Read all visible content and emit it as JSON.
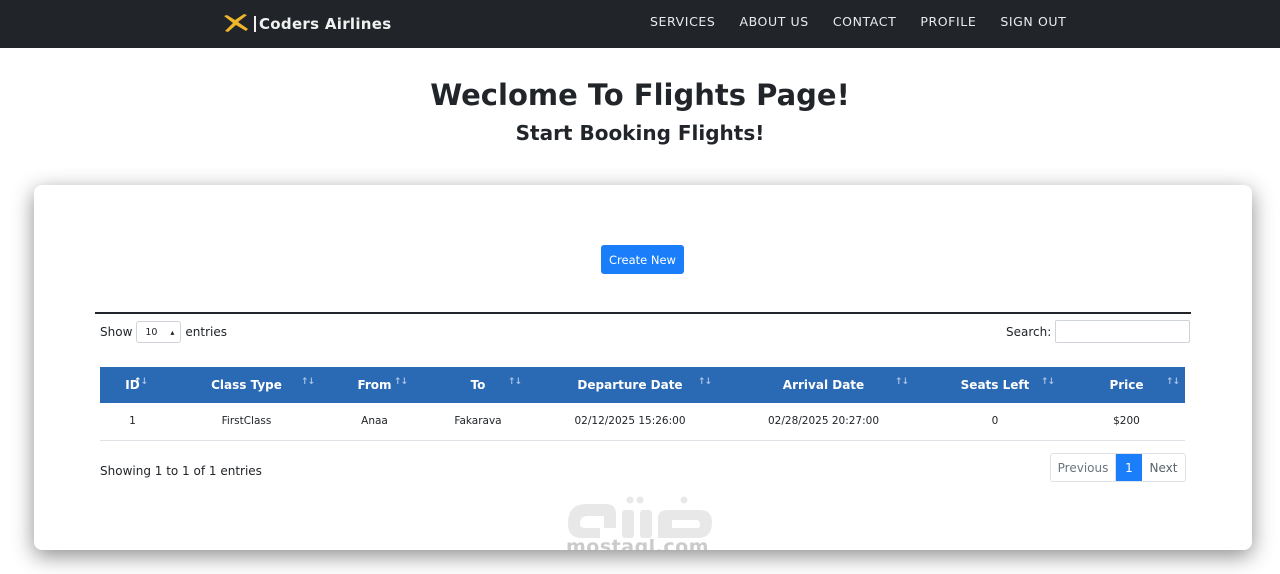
{
  "brand": {
    "name": "Coders Airlines",
    "icon": "airplane-icon",
    "accent": "#f0b62a"
  },
  "nav": {
    "items": [
      {
        "label": "SERVICES"
      },
      {
        "label": "ABOUT US"
      },
      {
        "label": "CONTACT"
      },
      {
        "label": "PROFILE"
      },
      {
        "label": "SIGN OUT"
      }
    ]
  },
  "page": {
    "title": "Weclome To Flights Page!",
    "subtitle": "Start Booking Flights!"
  },
  "actions": {
    "create_label": "Create New",
    "create_color": "#1a7efb"
  },
  "table_controls": {
    "show_label": "Show",
    "entries_label": "entries",
    "page_length": "10",
    "search_label": "Search:",
    "search_value": ""
  },
  "table": {
    "header_color": "#2a6ab4",
    "columns": [
      "ID",
      "Class Type",
      "From",
      "To",
      "Departure Date",
      "Arrival Date",
      "Seats Left",
      "Price"
    ],
    "rows": [
      [
        "1",
        "FirstClass",
        "Anaa",
        "Fakarava",
        "02/12/2025 15:26:00",
        "02/28/2025 20:27:00",
        "0",
        "$200"
      ]
    ]
  },
  "footer": {
    "info": "Showing 1 to 1 of 1 entries",
    "previous": "Previous",
    "current_page": "1",
    "next": "Next"
  },
  "watermark": {
    "text": "mostaql.com"
  }
}
